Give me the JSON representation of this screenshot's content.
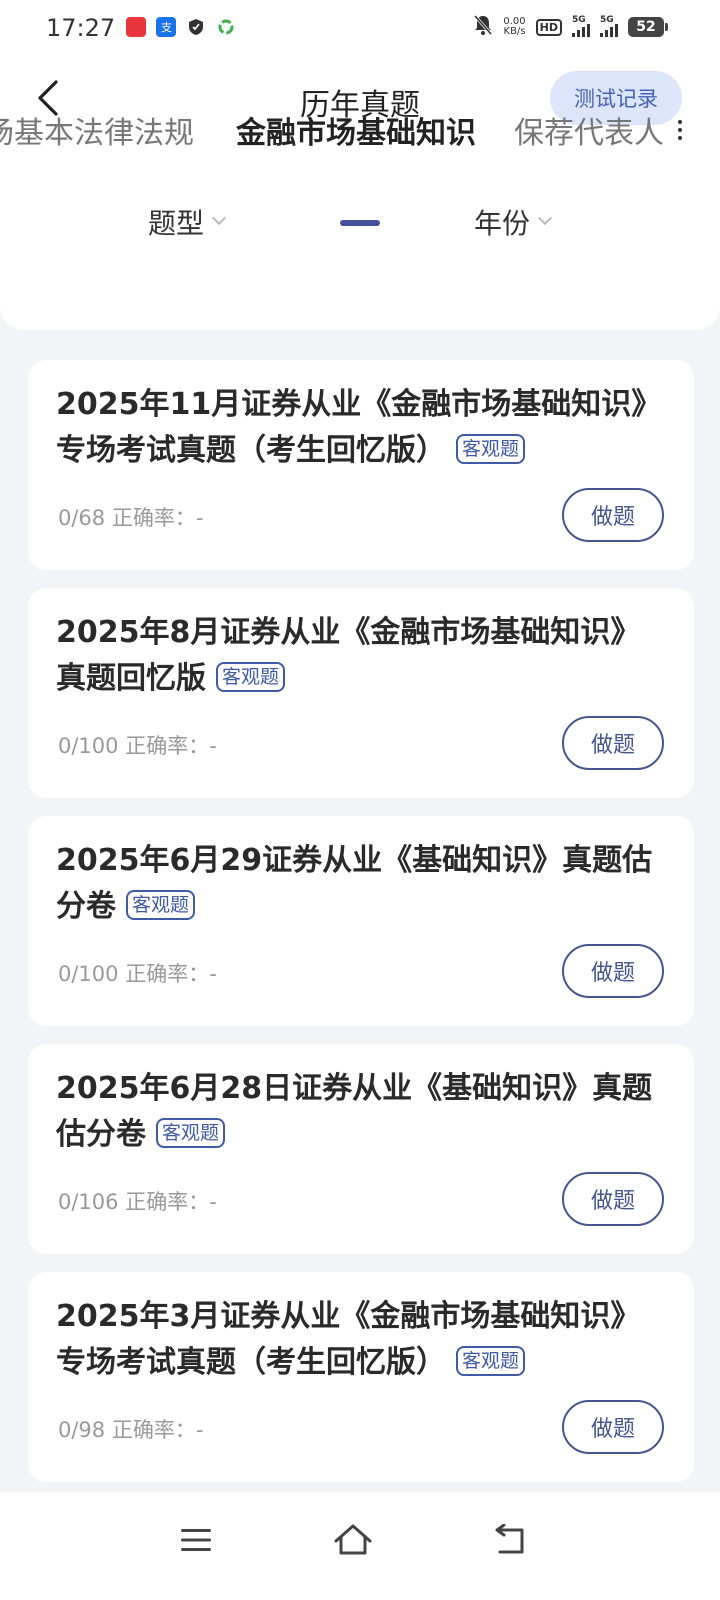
{
  "status_bar": {
    "time": "17:27",
    "net_speed_value": "0.00",
    "net_speed_unit": "KB/s",
    "hd_label": "HD",
    "signal_label_1": "5G",
    "signal_label_2": "5G",
    "battery": "52"
  },
  "header": {
    "title": "历年真题",
    "record_button": "测试记录"
  },
  "tabs": [
    {
      "label": "场基本法律法规"
    },
    {
      "label": "金融市场基础知识",
      "active": true
    },
    {
      "label": "保荐代表人"
    }
  ],
  "filters": {
    "type_label": "题型",
    "year_label": "年份"
  },
  "papers": [
    {
      "title": "2025年11月证券从业《金融市场基础知识》专场考试真题（考生回忆版）",
      "tag": "客观题",
      "progress": "0/68",
      "accuracy_label": "正确率：-",
      "action": "做题"
    },
    {
      "title": "2025年8月证券从业《金融市场基础知识》真题回忆版",
      "tag": "客观题",
      "progress": "0/100",
      "accuracy_label": "正确率：-",
      "action": "做题"
    },
    {
      "title": "2025年6月29证券从业《基础知识》真题估分卷",
      "tag": "客观题",
      "progress": "0/100",
      "accuracy_label": "正确率：-",
      "action": "做题"
    },
    {
      "title": "2025年6月28日证券从业《基础知识》真题估分卷",
      "tag": "客观题",
      "progress": "0/106",
      "accuracy_label": "正确率：-",
      "action": "做题"
    },
    {
      "title": "2025年3月证券从业《金融市场基础知识》专场考试真题（考生回忆版）",
      "tag": "客观题",
      "progress": "0/98",
      "accuracy_label": "正确率：-",
      "action": "做题"
    }
  ],
  "colors": {
    "accent": "#44539a",
    "record_bg": "#dde5fb",
    "page_bg": "#f3f4f7"
  }
}
